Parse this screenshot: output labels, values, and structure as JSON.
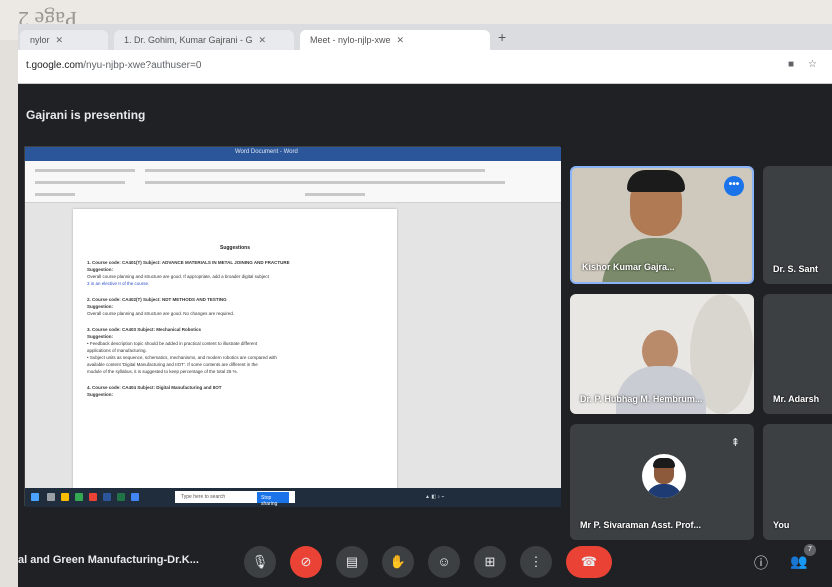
{
  "paper": {
    "page_label": "Page 2"
  },
  "browser": {
    "tabs": [
      {
        "label": "nylor",
        "active": false
      },
      {
        "label": "1. Dr. Gohim, Kumar Gajrani - G",
        "active": false
      },
      {
        "label": "Meet - nylo-njlp-xwe",
        "active": true
      }
    ],
    "new_tab": "+",
    "url_host": "t.google.com",
    "url_path": "/nyu-njbp-xwe?authuser=0"
  },
  "meet": {
    "presenting_text": "Gajrani is presenting",
    "document": {
      "title_bar": "Word Document - Word",
      "heading": "Suggestions",
      "lines": [
        {
          "text": "1. Course code: CA401(T) Subject: ADVANCE MATERIALS IN METAL JOINING AND FRACTURE",
          "style": "b"
        },
        {
          "text": "Suggestion:",
          "style": "b"
        },
        {
          "text": "Overall course planning and structure are good. If appropriate, add a broader digital subject",
          "style": ""
        },
        {
          "text": "3 in an elective II of the course.",
          "style": "blue"
        },
        {
          "text": "",
          "style": "gap"
        },
        {
          "text": "2. Course code: CA402(T) Subject: NDT METHODS AND TESTING",
          "style": "b"
        },
        {
          "text": "Suggestion:",
          "style": "b"
        },
        {
          "text": "Overall course planning and structure are good. No changes are required.",
          "style": ""
        },
        {
          "text": "",
          "style": "gap"
        },
        {
          "text": "3. Course code: CA403 Subject: Mechanical Robotics",
          "style": "b"
        },
        {
          "text": "Suggestion:",
          "style": "b"
        },
        {
          "text": "• Feedback description topic should be added in practical content to illustrate different",
          "style": ""
        },
        {
          "text": "  applications of manufacturing.",
          "style": ""
        },
        {
          "text": "• Subject units as sequence, schematics, mechanisms, and modern robotics are compared with",
          "style": ""
        },
        {
          "text": "  available content 'Digital Manufacturing and IIOT'. If some contents are different in the",
          "style": ""
        },
        {
          "text": "  module of the syllabus, it is suggested to keep percentage of the total 25 %.",
          "style": ""
        },
        {
          "text": "",
          "style": "gap"
        },
        {
          "text": "4. Course code: CA404 Subject: Digital Manufacturing and IIOT",
          "style": "b"
        },
        {
          "text": "Suggestion:",
          "style": "b"
        }
      ],
      "taskbar_search": "Type here to search",
      "taskbar_share": "Stop sharing"
    },
    "participants": [
      {
        "name": "Kishor Kumar Gajra...",
        "more": "•••"
      },
      {
        "name": "Dr. S. Sant"
      },
      {
        "name": "Dr. P. Hubhag M. Hembrum..."
      },
      {
        "name": "Mr. Adarsh"
      },
      {
        "name": "Mr P. Sivaraman Asst. Prof..."
      },
      {
        "name": "You"
      }
    ],
    "controls": {
      "meeting_title": "al and Green Manufacturing-Dr.K...",
      "people_count": "7"
    }
  },
  "colors": {
    "meet_bg": "#202124",
    "tile_bg": "#3c4043",
    "end_call": "#ea4335",
    "accent": "#1a73e8",
    "word_blue": "#2b579a"
  },
  "icons": [
    "mic-icon",
    "camera-off-icon",
    "captions-icon",
    "raise-hand-icon",
    "emoji-icon",
    "present-icon",
    "more-options-icon",
    "end-call-icon",
    "info-icon",
    "people-icon",
    "pin-icon"
  ]
}
